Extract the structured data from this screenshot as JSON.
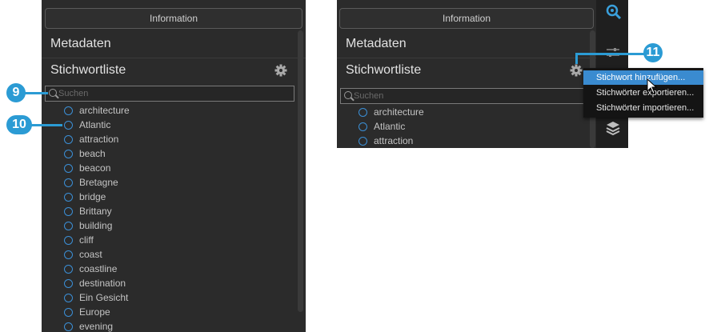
{
  "left": {
    "info_tab": "Information",
    "metadata_label": "Metadaten",
    "keywords_label": "Stichwortliste",
    "search_placeholder": "Suchen",
    "keywords": [
      "architecture",
      "Atlantic",
      "attraction",
      "beach",
      "beacon",
      "Bretagne",
      "bridge",
      "Brittany",
      "building",
      "cliff",
      "coast",
      "coastline",
      "destination",
      "Ein Gesicht",
      "Europe",
      "evening"
    ]
  },
  "right": {
    "info_tab": "Information",
    "metadata_label": "Metadaten",
    "keywords_label": "Stichwortliste",
    "search_placeholder": "Suchen",
    "keywords": [
      "architecture",
      "Atlantic",
      "attraction"
    ],
    "menu": [
      "Stichwort hinzufügen...",
      "Stichwörter exportieren...",
      "Stichwörter importieren..."
    ]
  },
  "callouts": {
    "c9": "9",
    "c10": "10",
    "c11": "11"
  },
  "icons": [
    "gear-icon",
    "search-icon",
    "zoom-tool-icon",
    "adjust-sliders-icon",
    "layers-icon",
    "mouse-cursor-icon"
  ],
  "colors": {
    "panel": "#2b2b2b",
    "accent": "#2b9bd4",
    "menu_highlight": "#3a8bd0",
    "keyword_circle": "#3b8fd6"
  }
}
